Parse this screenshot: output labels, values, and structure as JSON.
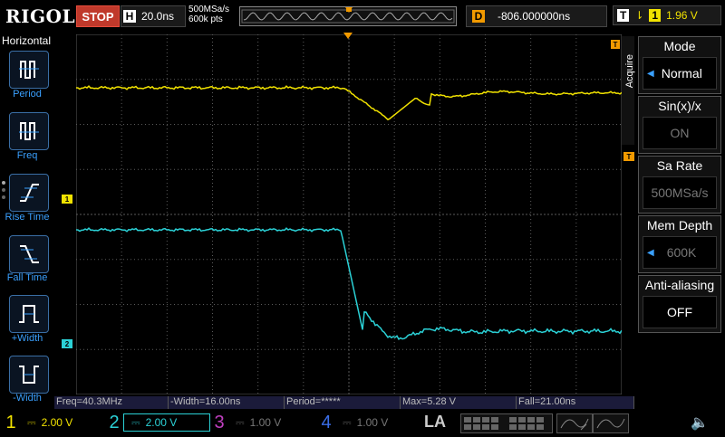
{
  "top": {
    "brand": "RIGOL",
    "run_state": "STOP",
    "horizontal_key": "H",
    "timebase": "20.0ns",
    "sample_rate": "500MSa/s",
    "memory_points": "600k pts",
    "delay_key": "D",
    "delay_value": "-806.000000ns",
    "trigger_key": "T",
    "trigger_source": "1",
    "trigger_level": "1.96 V"
  },
  "left_menu": {
    "title": "Horizontal",
    "items": [
      {
        "label": "Period"
      },
      {
        "label": "Freq"
      },
      {
        "label": "Rise Time"
      },
      {
        "label": "Fall Time"
      },
      {
        "label": "+Width"
      },
      {
        "label": "-Width"
      }
    ]
  },
  "right_menu": {
    "title": "Acquire",
    "buttons": [
      {
        "label": "Mode",
        "value": "Normal"
      },
      {
        "label": "Sin(x)/x",
        "value": "ON"
      },
      {
        "label": "Sa Rate",
        "value": "500MSa/s"
      },
      {
        "label": "Mem Depth",
        "value": "600K"
      },
      {
        "label": "Anti-aliasing",
        "value": "OFF"
      }
    ]
  },
  "markers": {
    "ch1": "1",
    "ch2": "2",
    "trig_pos": "T"
  },
  "measurements": [
    {
      "text": "Freq=40.3MHz"
    },
    {
      "text": "-Width=16.00ns"
    },
    {
      "text": "Period=*****"
    },
    {
      "text": "Max=5.28 V"
    },
    {
      "text": "Fall=21.00ns"
    }
  ],
  "channels": [
    {
      "num": "1",
      "scale": "2.00 V",
      "color": "#f1e200"
    },
    {
      "num": "2",
      "scale": "2.00 V",
      "color": "#2bd1d6"
    },
    {
      "num": "3",
      "scale": "1.00 V",
      "color": "#c040c0"
    },
    {
      "num": "4",
      "scale": "1.00 V",
      "color": "#3a6ee8"
    }
  ],
  "la_label": "LA",
  "colors": {
    "ch1": "#f1e200",
    "ch2": "#2bd1d6",
    "grid": "#5a5a5a",
    "trigger": "#f29a00"
  }
}
